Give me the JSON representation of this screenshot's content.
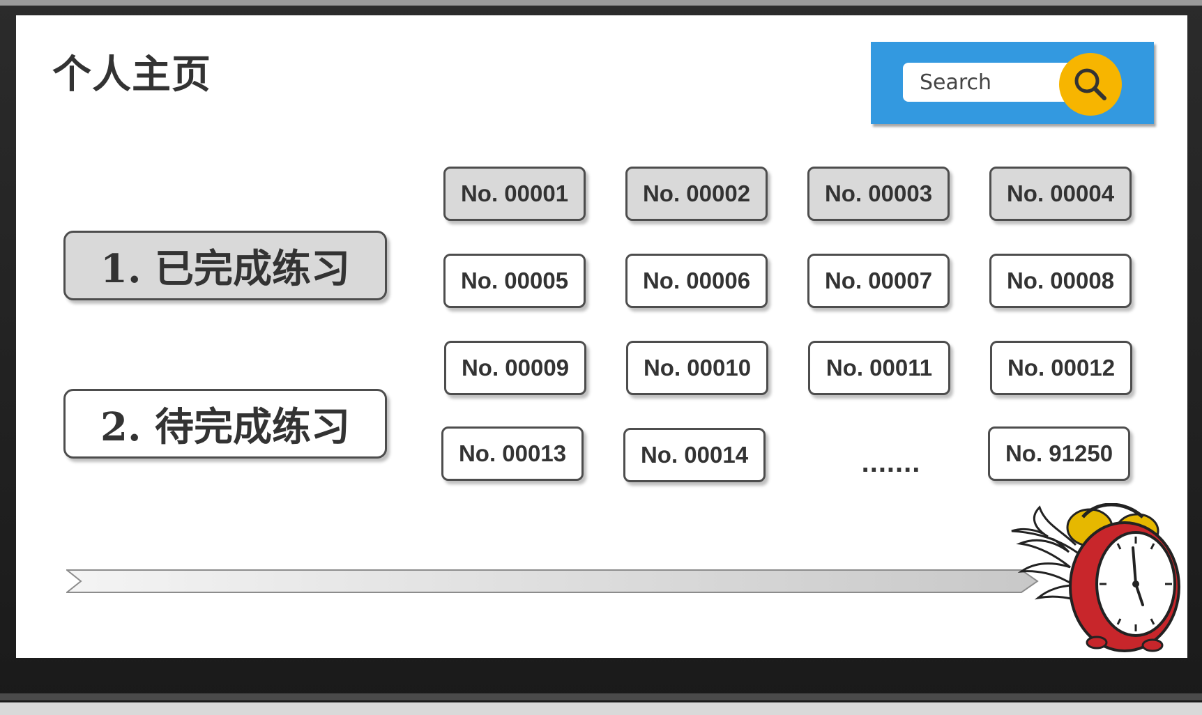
{
  "page": {
    "title": "个人主页"
  },
  "search": {
    "placeholder": "Search"
  },
  "categories": [
    {
      "label": "1. 已完成练习",
      "selected": true
    },
    {
      "label": "2. 待完成练习",
      "selected": false
    }
  ],
  "exercises": [
    {
      "label": "No. 00001",
      "done": true
    },
    {
      "label": "No. 00002",
      "done": true
    },
    {
      "label": "No. 00003",
      "done": true
    },
    {
      "label": "No. 00004",
      "done": true
    },
    {
      "label": "No. 00005",
      "done": false
    },
    {
      "label": "No. 00006",
      "done": false
    },
    {
      "label": "No. 00007",
      "done": false
    },
    {
      "label": "No. 00008",
      "done": false
    },
    {
      "label": "No. 00009",
      "done": false
    },
    {
      "label": "No. 00010",
      "done": false
    },
    {
      "label": "No. 00011",
      "done": false
    },
    {
      "label": "No. 00012",
      "done": false
    },
    {
      "label": "No. 00013",
      "done": false
    },
    {
      "label": "No. 00014",
      "done": false
    },
    {
      "label": "No. 91250",
      "done": false
    }
  ],
  "ellipsis": ".......",
  "icons": {
    "search": "search-icon",
    "clock": "winged-alarm-clock-icon",
    "progress": "progress-arrow"
  },
  "colors": {
    "search_panel": "#3399e0",
    "search_button": "#f7b500",
    "done_fill": "#d9d9d9",
    "todo_fill": "#ffffff",
    "border": "#4d4d4d"
  }
}
